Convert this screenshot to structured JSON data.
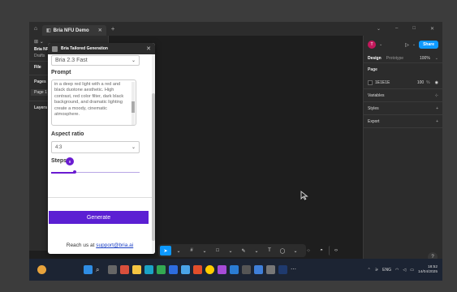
{
  "titlebar": {
    "tab_title": "Bria NFU Demo",
    "tab_close": "✕",
    "new_tab": "+",
    "minimize": "–",
    "maximize": "□",
    "close": "✕"
  },
  "leftpanel": {
    "file_name": "Bria NF",
    "drafts": "Drafts",
    "file_tab": "File",
    "pages": "Pages",
    "page1": "Page 1",
    "layers": "Layers"
  },
  "plugin": {
    "title": "Bria Tailored Generation",
    "close": "✕",
    "model_value": "Bria 2.3 Fast",
    "prompt_label": "Prompt",
    "prompt_text": "in a deep red light with a red and black duotone aesthetic. High contrast, red color filter, dark black background, and dramatic lighting create a moody, cinematic atmosphere.",
    "aspect_label": "Aspect ratio",
    "aspect_value": "4:3",
    "steps_label": "Steps",
    "steps_value": "8",
    "steps_fraction": 0.27,
    "generate_label": "Generate",
    "reach_prefix": "Reach us at ",
    "reach_email": "support@bria.ai"
  },
  "rightpanel": {
    "avatar": "T",
    "share": "Share",
    "tab_design": "Design",
    "tab_prototype": "Prototype",
    "zoom": "100%",
    "page_section": "Page",
    "bg_hex": "1E1E1E",
    "bg_opacity": "100",
    "bg_pct": "%",
    "variables": "Variables",
    "styles": "Styles",
    "export": "Export",
    "help": "?"
  },
  "taskbar": {
    "language": "ENG",
    "time": "18:52",
    "date": "14/04/2025"
  },
  "colors": {
    "accent_purple": "#5b1fd3",
    "figma_blue": "#0d99ff"
  }
}
